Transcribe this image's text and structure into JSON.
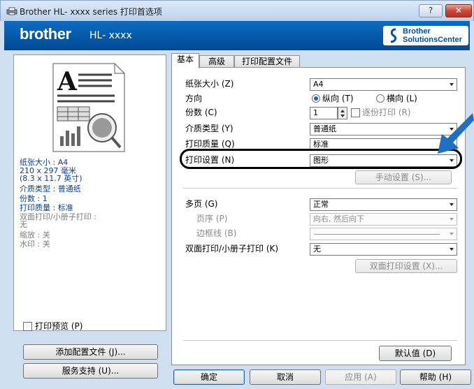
{
  "window": {
    "title": "Brother HL- xxxx series 打印首选项",
    "help": "?",
    "close": "✕"
  },
  "brand": {
    "logo": "brother",
    "model": "HL- xxxx",
    "solutions_line1": "Brother",
    "solutions_line2": "SolutionsCenter"
  },
  "summary": {
    "paper_size": "纸张大小 : A4",
    "paper_dims": "210 x 297 毫米",
    "paper_inch": "(8.3 x 11.7 英寸)",
    "media_type": "介质类型 : 普通纸",
    "copies": "份数 : 1",
    "quality": "打印质量 : 标准",
    "duplex": "双面打印/小册子打印 :",
    "duplex_val": "无",
    "scaling": "缩放 : 关",
    "watermark": "水印 : 关"
  },
  "preview_checkbox": "打印预览 (P)",
  "buttons": {
    "add_profile": "添加配置文件 (J)...",
    "support": "服务支持 (U)...",
    "ok": "确定",
    "cancel": "取消",
    "apply": "应用 (A)",
    "help": "帮助 (H)",
    "default": "默认值 (D)",
    "manual_settings": "手动设置 (S)...",
    "duplex_settings": "双面打印设置 (X)..."
  },
  "tabs": [
    "基本",
    "高级",
    "打印配置文件"
  ],
  "basic": {
    "paper_size_label": "纸张大小 (Z)",
    "paper_size_value": "A4",
    "orientation_label": "方向",
    "portrait": "纵向 (T)",
    "landscape": "横向 (L)",
    "copies_label": "份数 (C)",
    "copies_value": "1",
    "collate": "逐份打印 (R)",
    "media_label": "介质类型 (Y)",
    "media_value": "普通纸",
    "quality_label": "打印质量 (Q)",
    "quality_value": "标准",
    "print_setting_label": "打印设置 (N)",
    "print_setting_value": "图形",
    "multipage_label": "多页 (G)",
    "multipage_value": "正常",
    "page_order_label": "页序 (P)",
    "page_order_value": "向右, 然后向下",
    "border_label": "边框线 (B)",
    "duplex_label": "双面打印/小册子打印 (K)",
    "duplex_value": "无"
  },
  "colors": {
    "brand_blue": "#0a5db2",
    "highlight_ring": "#000000",
    "arrow_blue": "#1f6fc2"
  }
}
